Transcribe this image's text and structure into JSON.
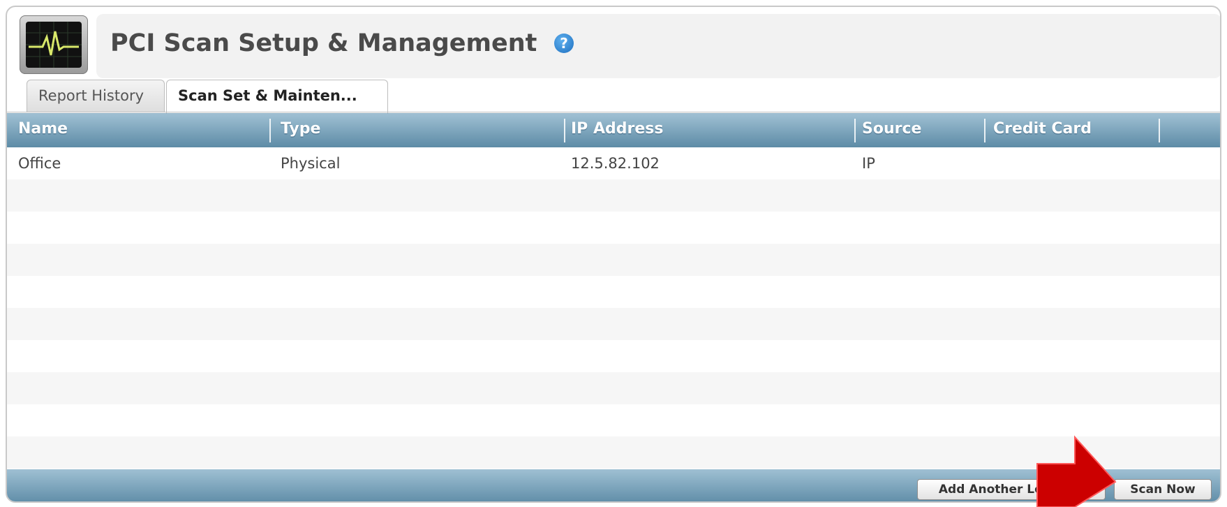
{
  "header": {
    "title": "PCI Scan Setup & Management",
    "help_symbol": "?"
  },
  "tabs": [
    {
      "label": "Report History",
      "active": false
    },
    {
      "label": "Scan Set & Mainten...",
      "active": true
    }
  ],
  "table": {
    "columns": [
      "Name",
      "Type",
      "IP Address",
      "Source",
      "Credit Card"
    ],
    "rows": [
      {
        "name": "Office",
        "type": "Physical",
        "ip": "12.5.82.102",
        "source": "IP",
        "credit_card": ""
      }
    ]
  },
  "footer": {
    "add_label": "Add Another Location",
    "scan_label": "Scan Now"
  },
  "colors": {
    "header_blue": "#5d8ba6",
    "annotation_arrow": "#cc0000",
    "help_blue": "#1d6fc0"
  },
  "icons": [
    "heartbeat-monitor-icon",
    "help-icon",
    "red-arrow-pointer"
  ]
}
